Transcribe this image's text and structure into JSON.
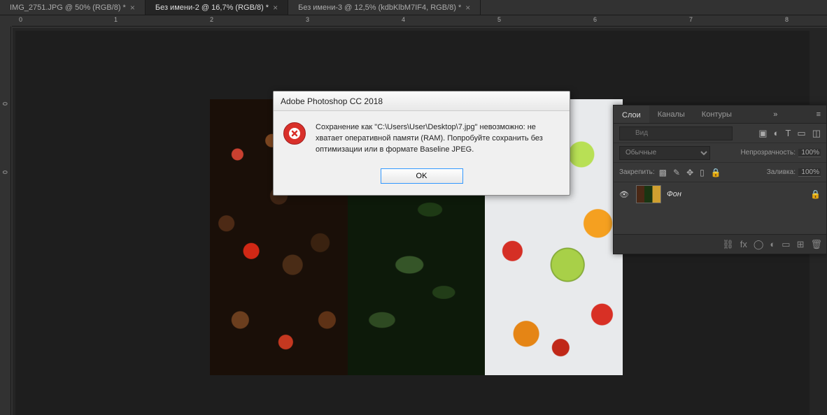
{
  "tabs": [
    {
      "label": "IMG_2751.JPG @ 50% (RGB/8) *"
    },
    {
      "label": "Без имени-2 @ 16,7% (RGB/8) *"
    },
    {
      "label": "Без имени-3 @ 12,5% (kdbKlbM7IF4, RGB/8) *"
    }
  ],
  "ruler_h": [
    "0",
    "1",
    "2",
    "3",
    "4",
    "5",
    "6",
    "7",
    "8"
  ],
  "ruler_v": [
    "0",
    "0"
  ],
  "dialog": {
    "title": "Adobe Photoshop CC 2018",
    "message": "Сохранение как \"C:\\Users\\User\\Desktop\\7.jpg\" невозможно: не хватает оперативной памяти (RAM). Попробуйте сохранить без оптимизации или в формате Baseline JPEG.",
    "ok": "OK"
  },
  "layers_panel": {
    "tabs": {
      "layers": "Слои",
      "channels": "Каналы",
      "paths": "Контуры"
    },
    "search_placeholder": "Вид",
    "blend_mode": "Обычные",
    "opacity_label": "Непрозрачность:",
    "opacity_value": "100%",
    "lock_label": "Закрепить:",
    "fill_label": "Заливка:",
    "fill_value": "100%",
    "layer_name": "Фон",
    "footer_fx": "fx"
  }
}
